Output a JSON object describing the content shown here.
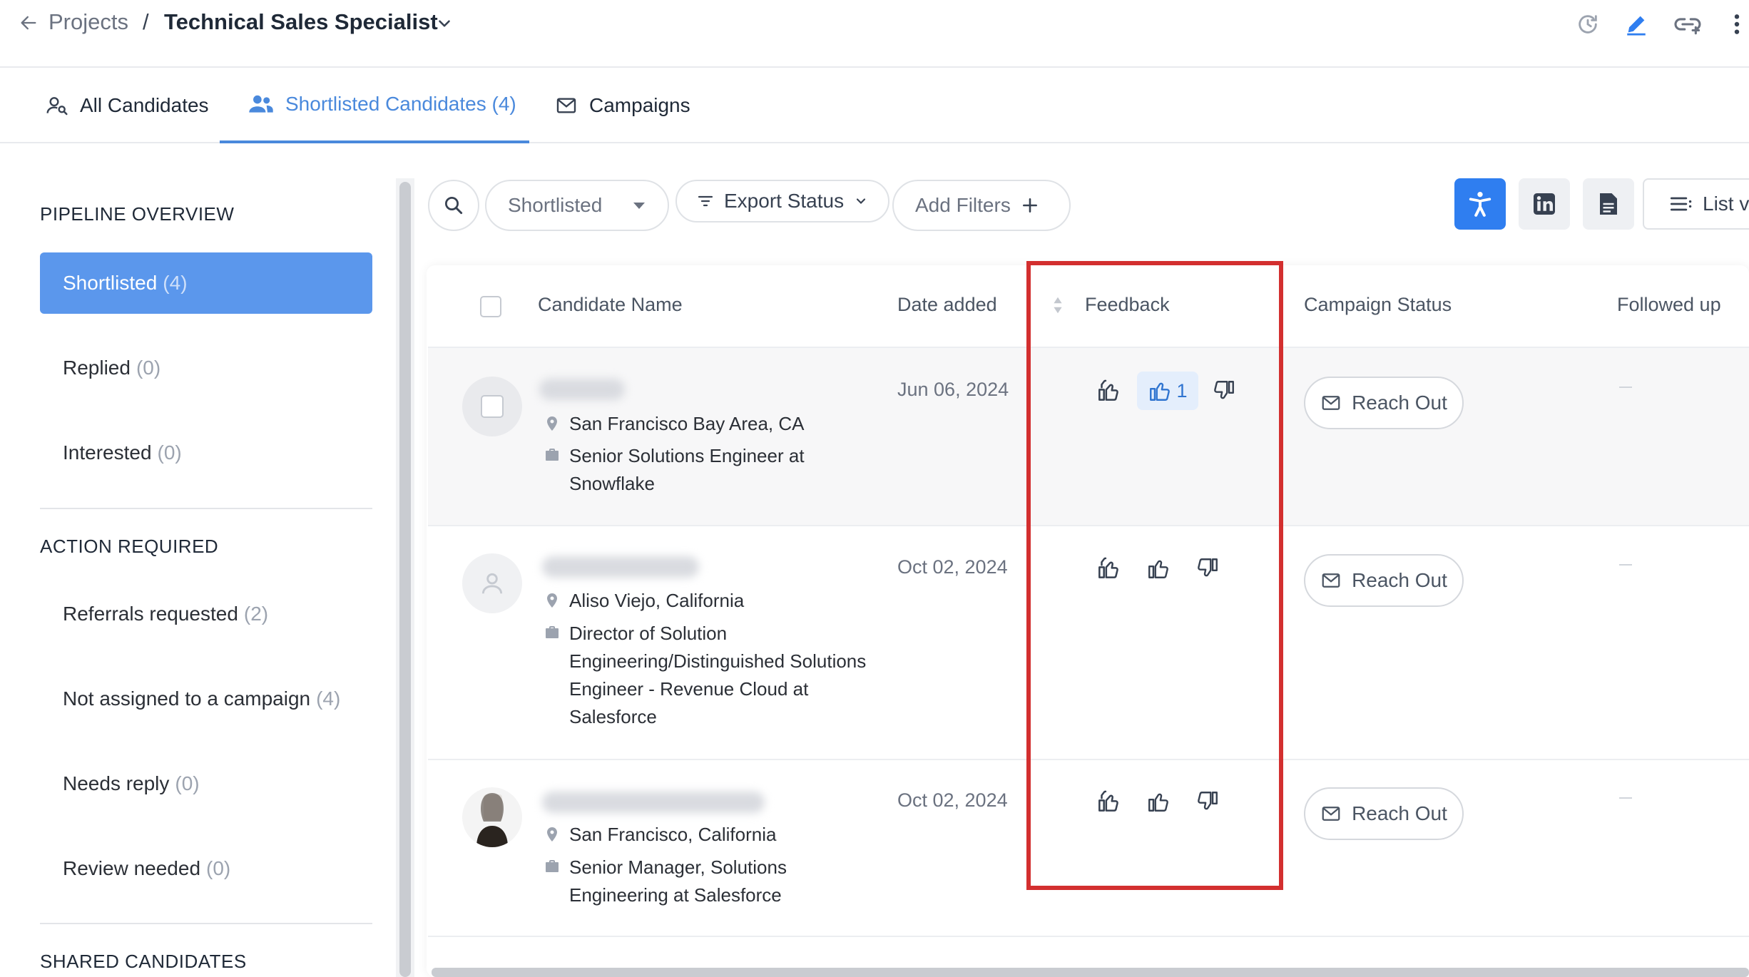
{
  "header": {
    "breadcrumb_projects": "Projects",
    "breadcrumb_sep": "/",
    "project_title": "Technical Sales Specialist"
  },
  "tabs": [
    {
      "label": "All Candidates"
    },
    {
      "label": "Shortlisted Candidates (4)"
    },
    {
      "label": "Campaigns"
    }
  ],
  "sidebar": {
    "pipeline_title": "PIPELINE OVERVIEW",
    "pipeline": [
      {
        "label": "Shortlisted",
        "count": "(4)"
      },
      {
        "label": "Replied",
        "count": "(0)"
      },
      {
        "label": "Interested",
        "count": "(0)"
      }
    ],
    "action_title": "ACTION REQUIRED",
    "actions": [
      {
        "label": "Referrals requested",
        "count": "(2)"
      },
      {
        "label": "Not assigned to a campaign",
        "count": "(4)"
      },
      {
        "label": "Needs reply",
        "count": "(0)"
      },
      {
        "label": "Review needed",
        "count": "(0)"
      }
    ],
    "shared_title": "SHARED CANDIDATES"
  },
  "filters": {
    "stage": "Shortlisted",
    "export_status": "Export Status",
    "add_filters": "Add Filters",
    "list_view": "List vi"
  },
  "table": {
    "headers": {
      "name": "Candidate Name",
      "date": "Date added",
      "feedback": "Feedback",
      "campaign": "Campaign Status",
      "followed": "Followed up"
    },
    "rows": [
      {
        "location": "San Francisco Bay Area, CA",
        "title_lines": [
          "Senior Solutions Engineer at",
          "Snowflake"
        ],
        "date": "Jun 06, 2024",
        "like_count": "1",
        "action": "Reach Out"
      },
      {
        "location": "Aliso Viejo, California",
        "title_lines": [
          "Director of Solution",
          "Engineering/Distinguished Solutions",
          "Engineer - Revenue Cloud at",
          "Salesforce"
        ],
        "date": "Oct 02, 2024",
        "action": "Reach Out"
      },
      {
        "location": "San Francisco, California",
        "title_lines": [
          "Senior Manager, Solutions",
          "Engineering at Salesforce"
        ],
        "date": "Oct 02, 2024",
        "action": "Reach Out"
      }
    ]
  },
  "colors": {
    "accent": "#4a89dc",
    "selected_pill": "#5b97ec",
    "highlight": "#d32f2f",
    "primary_button": "#2f7ef0"
  }
}
